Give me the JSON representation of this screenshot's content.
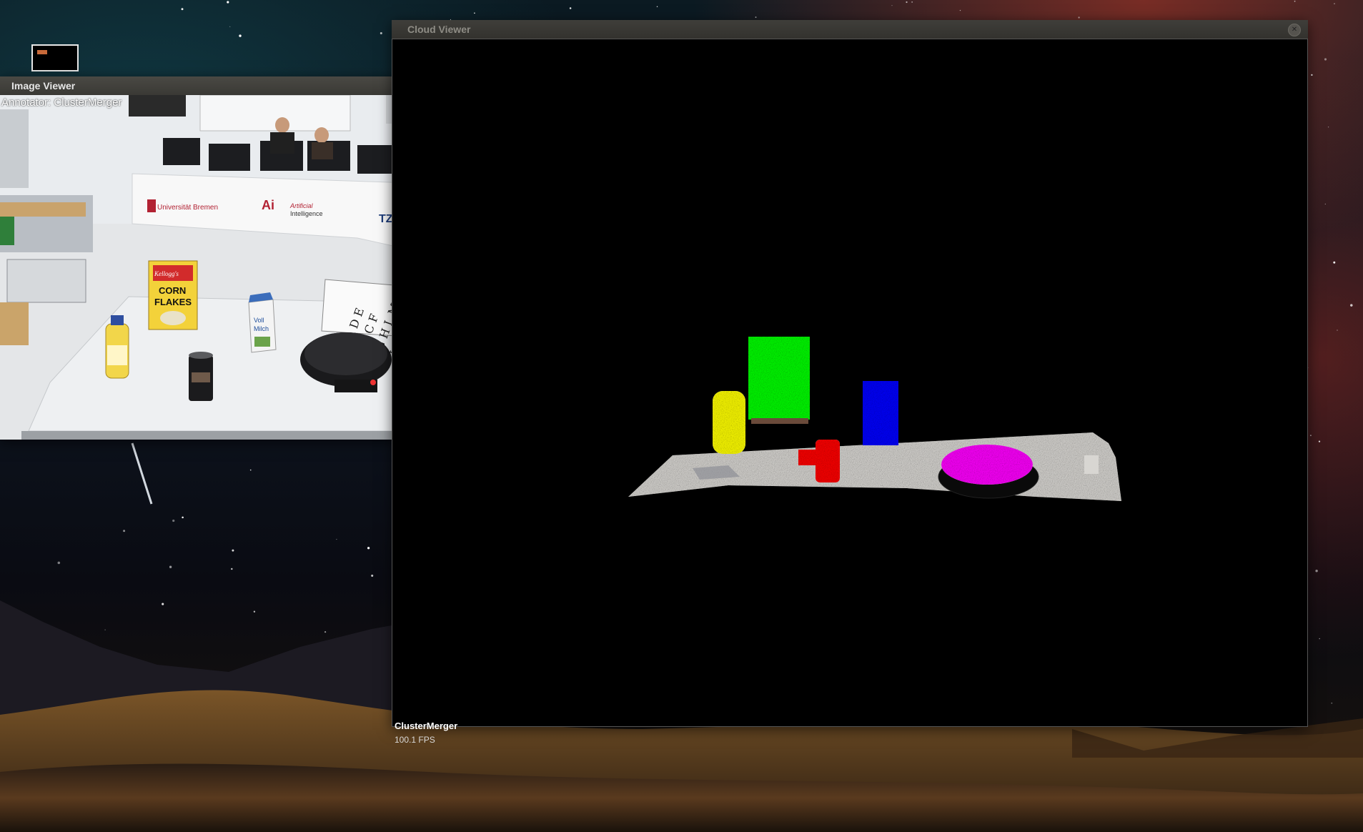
{
  "desktop": {
    "background": "night-sky-mountains",
    "workspace_switcher_icon": "workspace-thumbnail-icon"
  },
  "image_viewer": {
    "title": "Image Viewer",
    "annotator_label": "Annotator: ClusterMerger",
    "close_icon": "close-icon",
    "camera_texts": {
      "university": "Universität Bremen",
      "ai_1": "Artificial",
      "ai_2": "Intelligence",
      "tzi": "TZi",
      "cornflakes_brand": "Kellogg's",
      "cornflakes_1": "CORN",
      "cornflakes_2": "FLAKES",
      "milk_1": "Voll",
      "milk_2": "Milch",
      "letters": [
        "A D E",
        "B C F",
        "G H L M",
        "I J K N"
      ]
    }
  },
  "cloud_viewer": {
    "title": "Cloud Viewer",
    "close_icon": "close-icon",
    "annotator_name": "ClusterMerger",
    "fps": "100.1 FPS",
    "cluster_colors": {
      "table": "#d8d6d2",
      "yellow": "#ffff00",
      "green": "#00ff00",
      "red": "#ff0000",
      "blue": "#0000ff",
      "magenta": "#ff00ff"
    }
  }
}
